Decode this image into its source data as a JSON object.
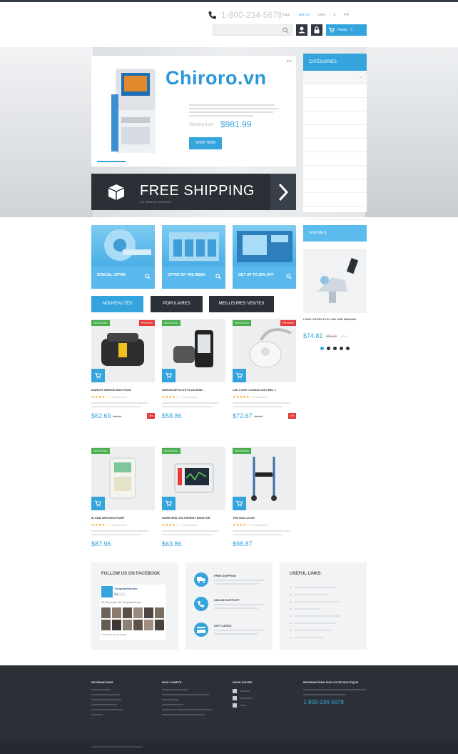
{
  "header": {
    "phone": "1-800-234-5678",
    "top_links": [
      "Lien",
      "Lien ici",
      "Lien",
      "€",
      "FR"
    ],
    "search_placeholder": "",
    "cart_label": "Panier",
    "cart_count": "0"
  },
  "hero": {
    "watermark": "Chiroro.vn",
    "description": "",
    "price_label": "Starting from",
    "price": "$981.99",
    "shop_button": "SHOP NOW",
    "shipping_title": "FREE SHIPPING",
    "shipping_subtitle": "ON ORDERS OVER $99"
  },
  "categories": {
    "title": "CATÉGORIES",
    "items": [
      "",
      "",
      "",
      "",
      "",
      "",
      "",
      "",
      "",
      "",
      "",
      ""
    ]
  },
  "tiles": [
    {
      "label": "SPECIAL OFFER",
      "sub": ""
    },
    {
      "label": "OFFER OF THE WEEK",
      "sub": ""
    },
    {
      "label": "GET UP TO 25% OFF",
      "sub": ""
    }
  ],
  "specials": {
    "title": "SPECIALS",
    "name": "LONG CROSS FLEX INK AND IMAGING",
    "price": "$74.81",
    "old_price": "$89.99",
    "discount": "-10%"
  },
  "tabs": [
    "NOUVEAUTÉS",
    "POPULAIRES",
    "MEILLEURES VENTES"
  ],
  "products": [
    {
      "badge": "NOUVEAU",
      "badge2": "PROMO!",
      "name": "MARKET BRIDGE BAG PACK",
      "stars": "★★★★☆",
      "reviews": "1 Commentaire",
      "price": "$62.69",
      "old": "$65.99",
      "pct": "-5%"
    },
    {
      "badge": "NOUVEAU",
      "badge2": "",
      "name": "OMRON BP ELITE PLUS ARM...",
      "stars": "★★★★☆",
      "reviews": "1 Commentaire",
      "price": "$58.86",
      "old": "",
      "pct": ""
    },
    {
      "badge": "NOUVEAU",
      "badge2": "PROMO!",
      "name": "LED LIGHT CURING UNIT BEL 1",
      "stars": "★★★★★",
      "reviews": "1 Commentaire",
      "price": "$72.67",
      "old": "$76.50",
      "pct": "-5%"
    },
    {
      "badge": "NOUVEAU",
      "badge2": "",
      "name": "IN AND INFUSION PUMP",
      "stars": "★★★★☆",
      "reviews": "1 Commentaire",
      "price": "$87.96",
      "old": "",
      "pct": ""
    },
    {
      "badge": "NOUVEAU",
      "badge2": "",
      "name": "SUREVIEW VS4 PATIENT MONITOR",
      "stars": "★★★★☆",
      "reviews": "1 Commentaire",
      "price": "$63.86",
      "old": "",
      "pct": ""
    },
    {
      "badge": "NOUVEAU",
      "badge2": "",
      "name": "THE ROLLATOR",
      "stars": "★★★★☆",
      "reviews": "1 Commentaire",
      "price": "$98.87",
      "old": "",
      "pct": ""
    }
  ],
  "facebook": {
    "title": "FOLLOW US ON FACEBOOK",
    "page_name": "TemplateMonster",
    "like": "Like",
    "people": "30,000 people like TemplateMonster",
    "plugin": "Facebook social plugin"
  },
  "services": [
    {
      "title": "FREE SHIPPING",
      "icon": "truck-icon"
    },
    {
      "title": "ONLINE SUPPORT",
      "icon": "phone-icon"
    },
    {
      "title": "GIFT CARDS",
      "icon": "card-icon"
    }
  ],
  "useful_links": {
    "title": "USEFUL LINKS"
  },
  "footer": {
    "col1": "INFORMATIONS",
    "col2": "MON COMPTE",
    "col3": "NOUS SUIVRE",
    "col4": "INFORMATIONS SUR VOTRE BOUTIQUE",
    "phone": "1-800-234-5678"
  },
  "colors": {
    "accent": "#35a4dd",
    "dark": "#2b3037",
    "new": "#49ad4c",
    "sale": "#e63a3a"
  }
}
